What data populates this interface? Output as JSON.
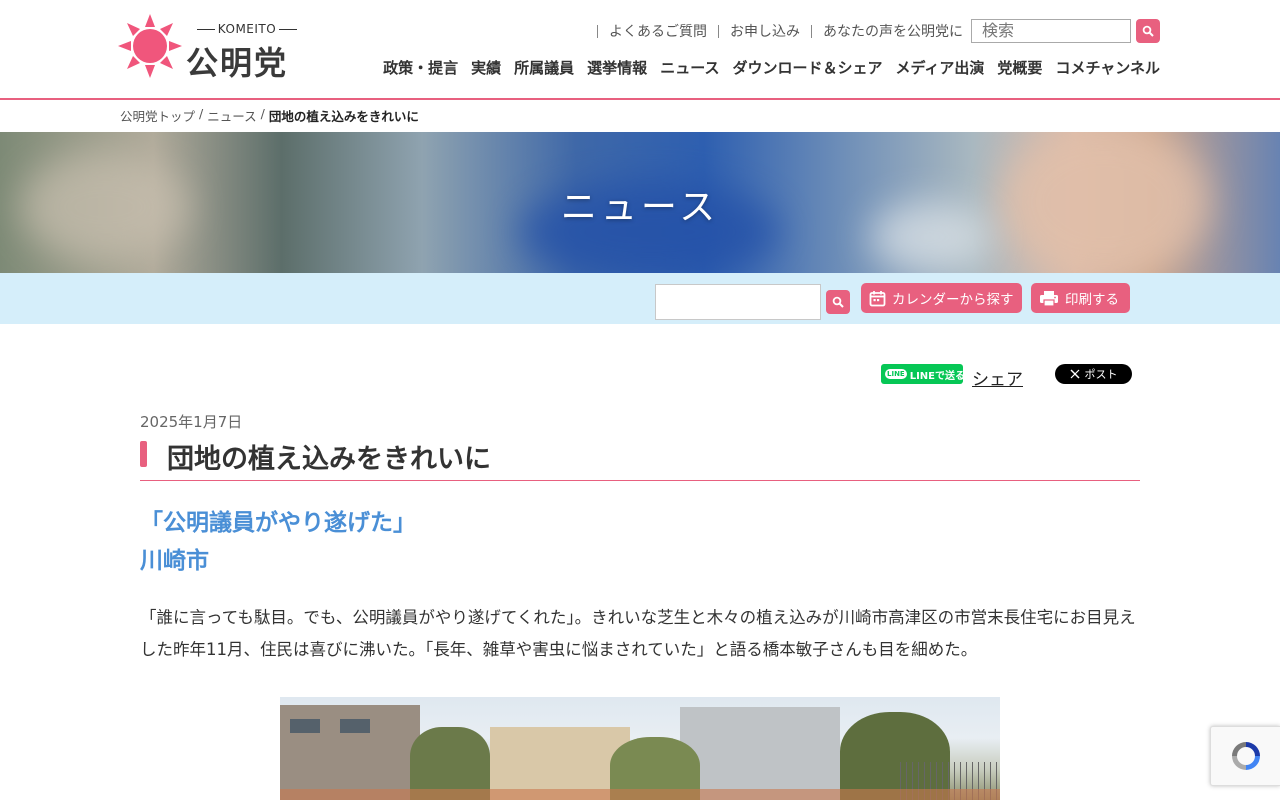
{
  "header": {
    "logo_sub": "KOMEITO",
    "logo_name": "公明党",
    "util_links": [
      "よくあるご質問",
      "お申し込み",
      "あなたの声を公明党に"
    ],
    "search_placeholder": "検索",
    "main_nav": [
      "政策・提言",
      "実績",
      "所属議員",
      "選挙情報",
      "ニュース",
      "ダウンロード＆シェア",
      "メディア出演",
      "党概要",
      "コメチャンネル"
    ]
  },
  "breadcrumb": {
    "items": [
      "公明党トップ",
      "ニュース"
    ],
    "current": "団地の植え込みをきれいに",
    "separator": "/"
  },
  "hero": {
    "title": "ニュース"
  },
  "toolbar": {
    "calendar_label": "カレンダーから探す",
    "print_label": "印刷する"
  },
  "share": {
    "line_label": "LINEで送る",
    "line_mark": "LINE",
    "share_label": "シェア",
    "x_label": "ポスト"
  },
  "article": {
    "date": "2025年1月7日",
    "title": "団地の植え込みをきれいに",
    "subhead_1": "「公明議員がやり遂げた」",
    "subhead_2": "川崎市",
    "paragraph_1": "「誰に言っても駄目。でも、公明議員がやり遂げてくれた」。きれいな芝生と木々の植え込みが川崎市高津区の市営末長住宅にお目見えした昨年11月、住民は喜びに沸いた。「長年、雑草や害虫に悩まされていた」と語る橋本敏子さんも目を細めた。"
  },
  "colors": {
    "brand_pink": "#e8607f",
    "subhead_blue": "#4a8fd6",
    "toolbar_bg": "#d5eefa"
  }
}
